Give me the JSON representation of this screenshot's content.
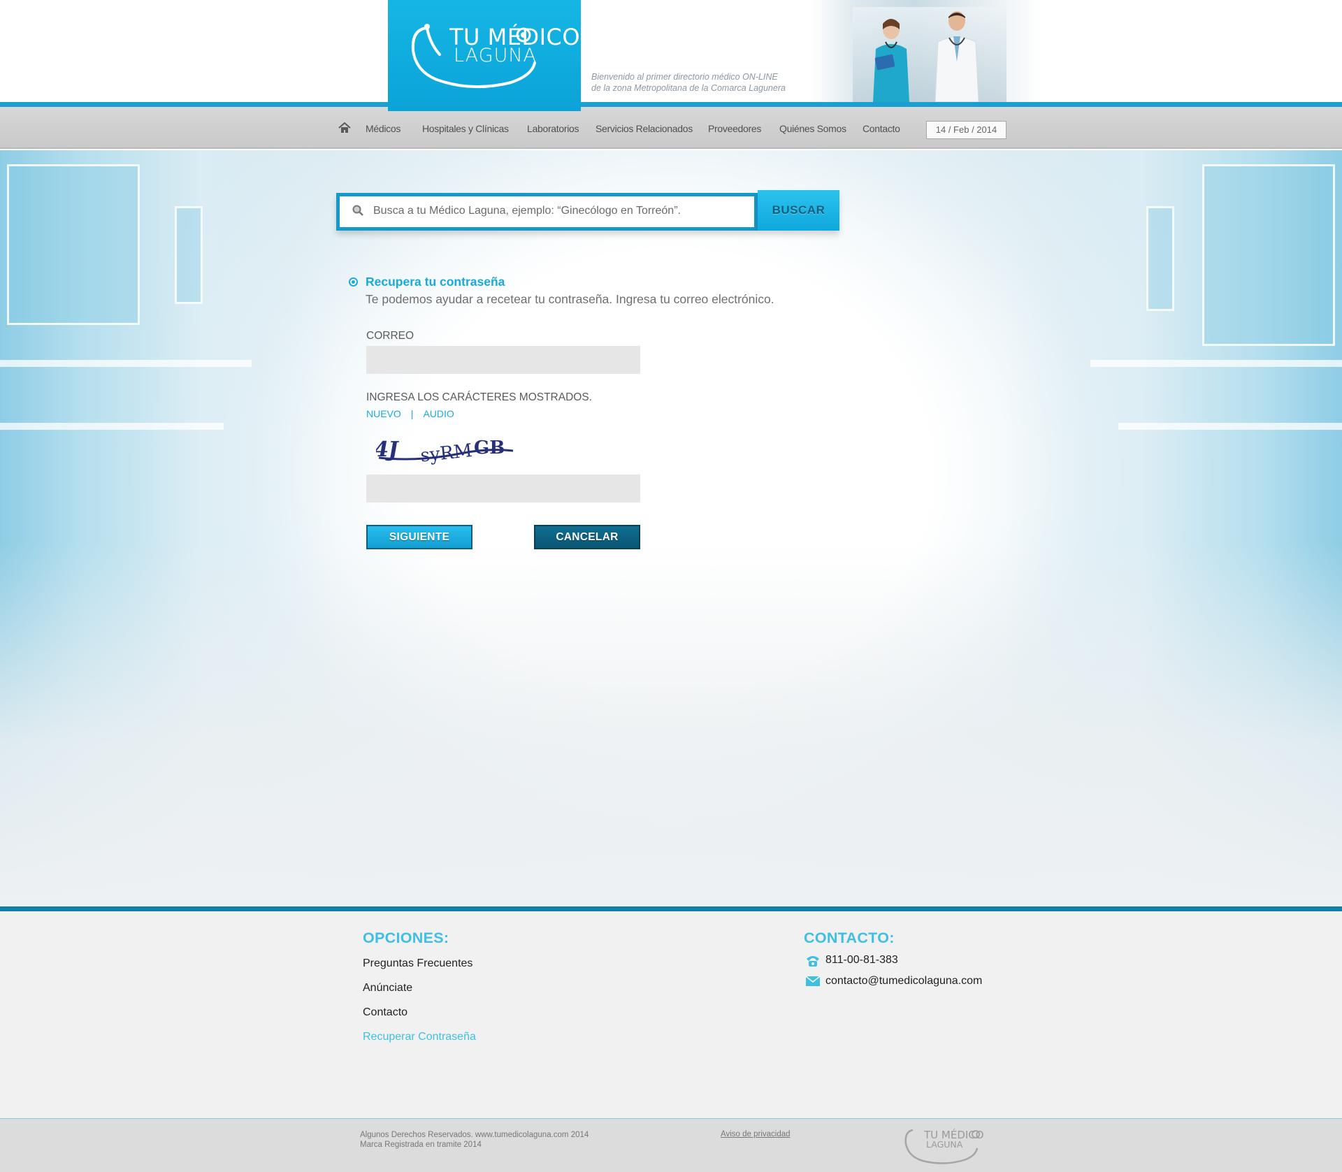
{
  "header": {
    "logo_line1": "TU MÉDICO",
    "logo_line2": "LAGUNA",
    "tagline_line1": "Bienvenido al primer directorio médico ON-LINE",
    "tagline_line2": "de la zona Metropolitana de la Comarca Lagunera"
  },
  "nav": {
    "home_icon": "home-icon",
    "items": [
      "Médicos",
      "Hospitales y Clínicas",
      "Laboratorios",
      "Servicios Relacionados",
      "Proveedores",
      "Quiénes Somos",
      "Contacto"
    ],
    "date": "14 / Feb / 2014"
  },
  "search": {
    "placeholder": "Busca a tu Médico Laguna, ejemplo: “Ginecólogo en Torreón”.",
    "button": "BUSCAR",
    "icon": "search-icon"
  },
  "form": {
    "title": "Recupera tu contraseña",
    "subtitle": "Te podemos ayudar a recetear tu contraseña. Ingresa tu correo electrónico.",
    "email_label": "CORREO",
    "email_value": "",
    "captcha_label": "INGRESA LOS CARÁCTERES MOSTRADOS.",
    "captcha_new": "NUEVO",
    "captcha_sep": "|",
    "captcha_audio": "AUDIO",
    "captcha_text": "4JsyRMGB",
    "captcha_value": "",
    "next_button": "SIGUIENTE",
    "cancel_button": "CANCELAR"
  },
  "footer": {
    "options_heading": "OPCIONES:",
    "options": [
      "Preguntas Frecuentes",
      "Anúnciate",
      "Contacto",
      "Recuperar Contraseña"
    ],
    "contact_heading": "CONTACTO:",
    "phone": "811-00-81-383",
    "email": "contacto@tumedicolaguna.com",
    "copyright_line1": "Algunos Derechos Reservados. www.tumedicolaguna.com 2014",
    "copyright_line2": "Marca Registrada en tramite 2014",
    "privacy": "Aviso de privacidad",
    "mini_logo_line1": "TU MÉDICO",
    "mini_logo_line2": "LAGUNA"
  },
  "colors": {
    "accent": "#1aabdf",
    "dark_accent": "#0a5574",
    "nav_bg": "#cfcfcf"
  }
}
